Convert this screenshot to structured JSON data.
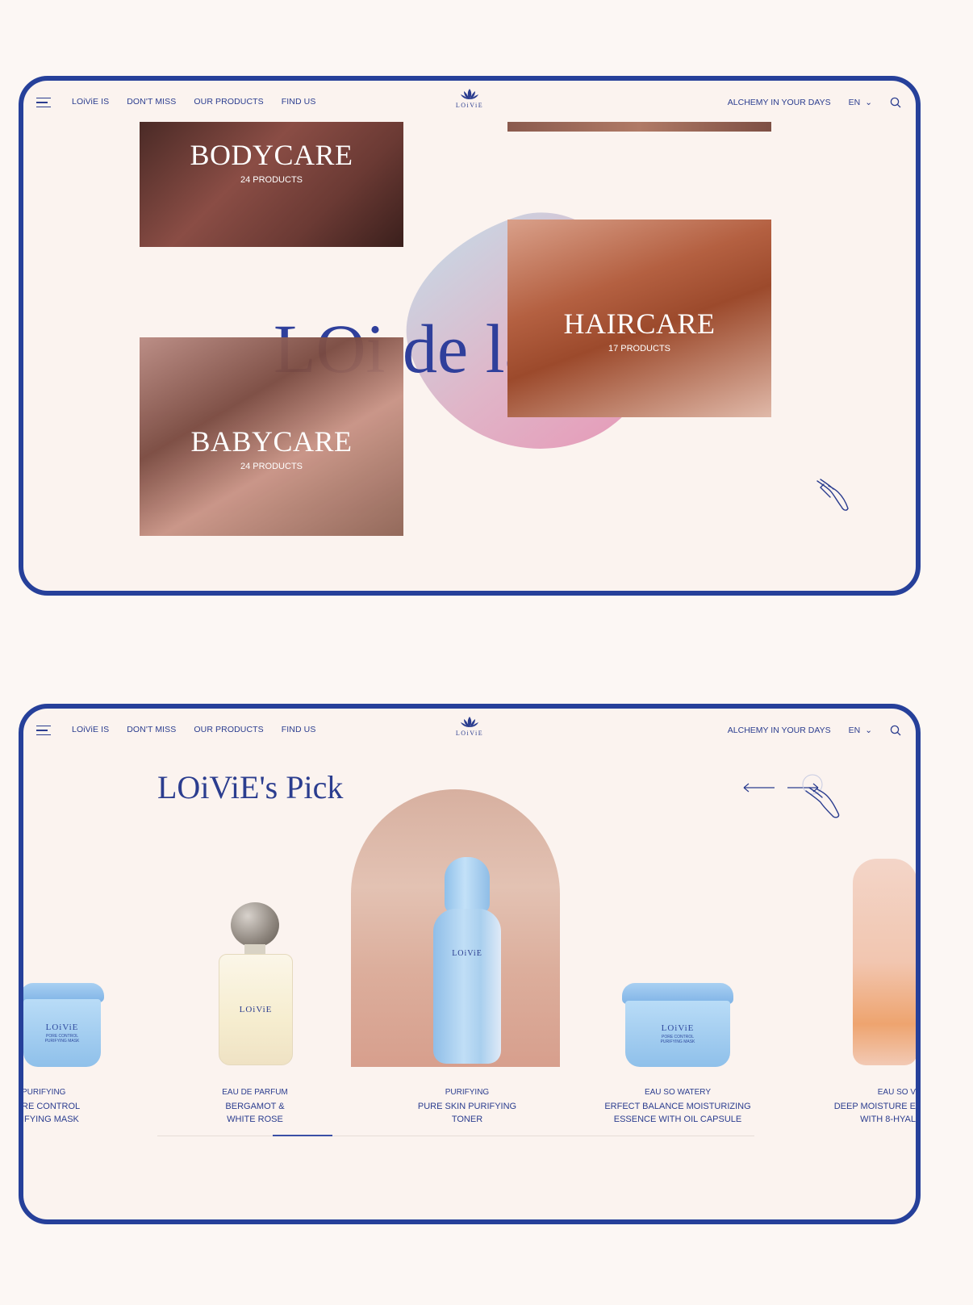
{
  "nav": {
    "links": [
      "LOiViE IS",
      "DON'T MISS",
      "OUR PRODUCTS",
      "FIND US"
    ],
    "logo_text": "LOiViE",
    "alchemy": "ALCHEMY IN YOUR DAYS",
    "lang": "EN"
  },
  "categories": {
    "bodycare": {
      "title": "BODYCARE",
      "count": "24 PRODUCTS"
    },
    "haircare": {
      "title": "HAIRCARE",
      "count": "17 PRODUCTS"
    },
    "babycare": {
      "title": "BABYCARE",
      "count": "24 PRODUCTS"
    },
    "background_script": "LOi de la"
  },
  "picks": {
    "title": "LOiViE's Pick",
    "products": [
      {
        "category": "PURIFYING",
        "line1": "RE CONTROL",
        "line2": "IFYING MASK",
        "brand": "LOiViE",
        "pack": "PORE CONTROL\nPURIFYING MASK"
      },
      {
        "category": "EAU DE PARFUM",
        "line1": "BERGAMOT &",
        "line2": "WHITE ROSE",
        "brand": "LOiViE"
      },
      {
        "category": "PURIFYING",
        "line1": "PURE SKIN PURIFYING",
        "line2": "TONER",
        "brand": "LOiViE"
      },
      {
        "category": "EAU SO WATERY",
        "line1": "ERFECT BALANCE MOISTURIZING",
        "line2": "ESSENCE WITH OIL CAPSULE",
        "brand": "LOiViE",
        "pack": "PORE CONTROL\nPURIFYING MASK"
      },
      {
        "category": "EAU SO V",
        "line1": "DEEP MOISTURE E",
        "line2": "WITH 8-HYAL"
      }
    ],
    "progress": 0.1
  },
  "colors": {
    "accent": "#2b3d8f",
    "frame": "#26409a",
    "background": "#fcf7f4"
  }
}
